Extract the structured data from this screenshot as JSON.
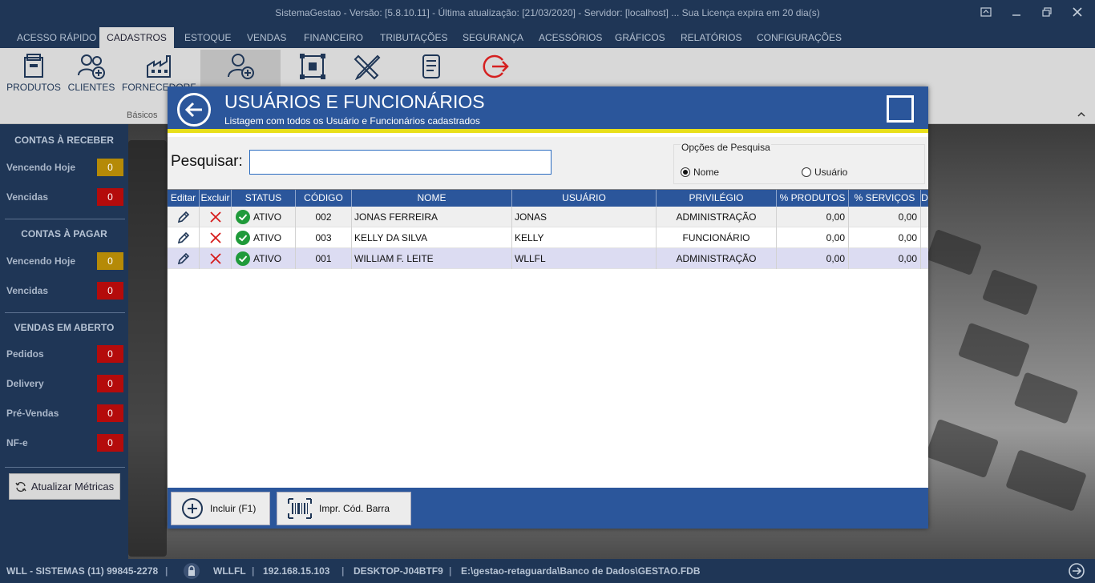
{
  "window": {
    "title": "SistemaGestao - Versão: [5.8.10.11] - Última atualização: [21/03/2020] - Servidor: [localhost] ... Sua Licença expira em 20 dia(s)"
  },
  "menu": {
    "tabs": [
      "ACESSO RÁPIDO",
      "CADASTROS",
      "ESTOQUE",
      "VENDAS",
      "FINANCEIRO",
      "TRIBUTAÇÕES",
      "SEGURANÇA",
      "ACESSÓRIOS",
      "GRÁFICOS",
      "RELATÓRIOS",
      "CONFIGURAÇÕES"
    ],
    "active": "CADASTROS"
  },
  "ribbon": {
    "buttons": [
      "PRODUTOS",
      "CLIENTES",
      "FORNECEDORES"
    ],
    "group_label": "Básicos"
  },
  "sidebar": {
    "receber": {
      "title": "CONTAS À RECEBER",
      "rows": [
        {
          "label": "Vencendo Hoje",
          "count": "0"
        },
        {
          "label": "Vencidas",
          "count": "0"
        }
      ]
    },
    "pagar": {
      "title": "CONTAS À PAGAR",
      "rows": [
        {
          "label": "Vencendo Hoje",
          "count": "0"
        },
        {
          "label": "Vencidas",
          "count": "0"
        }
      ]
    },
    "vendas": {
      "title": "VENDAS EM ABERTO",
      "rows": [
        {
          "label": "Pedidos",
          "count": "0"
        },
        {
          "label": "Delivery",
          "count": "0"
        },
        {
          "label": "Pré-Vendas",
          "count": "0"
        },
        {
          "label": "NF-e",
          "count": "0"
        }
      ]
    },
    "refresh_label": "Atualizar Métricas"
  },
  "status_bar": {
    "company": "WLL - SISTEMAS (11) 99845-2278",
    "user": "WLLFL",
    "ip": "192.168.15.103",
    "machine": "DESKTOP-J04BTF9",
    "db": "E:\\gestao-retaguarda\\Banco de Dados\\GESTAO.FDB"
  },
  "modal": {
    "title": "USUÁRIOS E FUNCIONÁRIOS",
    "subtitle": "Listagem com todos os Usuário e Funcionários cadastrados",
    "search_label": "Pesquisar:",
    "search_value": "",
    "options_legend": "Opções de Pesquisa",
    "option_nome": "Nome",
    "option_usuario": "Usuário",
    "selected_option": "Nome",
    "columns": [
      "Editar",
      "Excluir",
      "STATUS",
      "CÓDIGO",
      "NOME",
      "USUÁRIO",
      "PRIVILÉGIO",
      "% PRODUTOS",
      "% SERVIÇOS",
      "D"
    ],
    "rows": [
      {
        "status": "ATIVO",
        "codigo": "002",
        "nome": "JONAS FERREIRA",
        "usuario": "JONAS",
        "privilegio": "ADMINISTRAÇÃO",
        "produtos": "0,00",
        "servicos": "0,00"
      },
      {
        "status": "ATIVO",
        "codigo": "003",
        "nome": "KELLY DA SILVA",
        "usuario": "KELLY",
        "privilegio": "FUNCIONÁRIO",
        "produtos": "0,00",
        "servicos": "0,00"
      },
      {
        "status": "ATIVO",
        "codigo": "001",
        "nome": "WILLIAM F. LEITE",
        "usuario": "WLLFL",
        "privilegio": "ADMINISTRAÇÃO",
        "produtos": "0,00",
        "servicos": "0,00"
      }
    ],
    "footer": {
      "incluir_label": "Incluir (F1)",
      "impr_label": "Impr. Cód. Barra"
    }
  },
  "colors": {
    "brand": "#2b569b",
    "dark": "#1f3656",
    "accent": "#e8df1a",
    "ok": "#1f9a3a",
    "danger": "#d61b1b"
  }
}
